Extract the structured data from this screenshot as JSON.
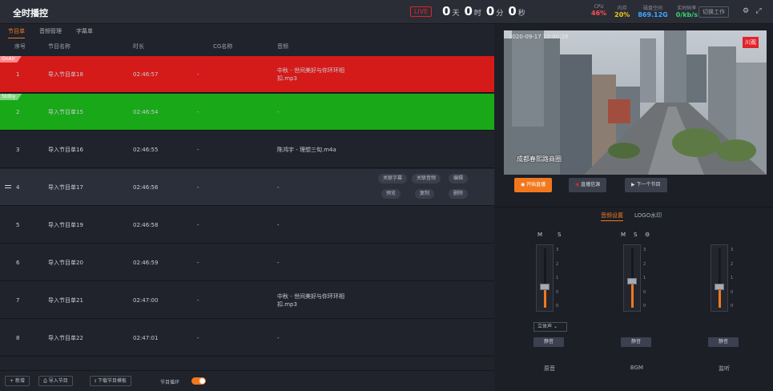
{
  "app": {
    "title": "全时播控"
  },
  "live": {
    "badge": "LIVE"
  },
  "timer": {
    "days": "0",
    "day_unit": "天",
    "hours": "0",
    "hour_unit": "时",
    "minutes": "0",
    "minute_unit": "分",
    "seconds": "0",
    "second_unit": "秒"
  },
  "stats": [
    {
      "label": "CPU",
      "value": "46%",
      "color": "#ff4f4f"
    },
    {
      "label": "内存",
      "value": "20%",
      "color": "#f5c518"
    },
    {
      "label": "磁盘空间",
      "value": "869.12G",
      "color": "#3fa7ff"
    },
    {
      "label": "实时码率",
      "value": "0/kb/s",
      "color": "#36d36e"
    }
  ],
  "top_button": "切换工作",
  "tabs": [
    "节目单",
    "音频管理",
    "字幕单"
  ],
  "columns": {
    "no": "序号",
    "name": "节目名称",
    "duration": "时长",
    "cg": "CG名称",
    "audio": "音频"
  },
  "rows": [
    {
      "no": "1",
      "name": "导入节目单18",
      "duration": "02:46:57",
      "cg": "-",
      "audio": "中秋 - 世间美好与你环环相扣.mp3",
      "tag": "OnAir"
    },
    {
      "no": "2",
      "name": "导入节目单15",
      "duration": "02:46:54",
      "cg": "-",
      "audio": "-",
      "tag": "Stdby"
    },
    {
      "no": "3",
      "name": "导入节目单16",
      "duration": "02:46:55",
      "cg": "-",
      "audio": "陈鸿宇 - 理想三旬.m4a"
    },
    {
      "no": "4",
      "name": "导入节目单17",
      "duration": "02:46:56",
      "cg": "-",
      "audio": "-"
    },
    {
      "no": "5",
      "name": "导入节目单19",
      "duration": "02:46:58",
      "cg": "-",
      "audio": "-"
    },
    {
      "no": "6",
      "name": "导入节目单20",
      "duration": "02:46:59",
      "cg": "-",
      "audio": "-"
    },
    {
      "no": "7",
      "name": "导入节目单21",
      "duration": "02:47:00",
      "cg": "-",
      "audio": "中秋 - 世间美好与你环环相扣.mp3"
    },
    {
      "no": "8",
      "name": "导入节目单22",
      "duration": "02:47:01",
      "cg": "-",
      "audio": "-"
    }
  ],
  "row_actions": {
    "link_subtitle": "关联字幕",
    "link_audio": "关联音频",
    "edit": "编辑",
    "preview": "预览",
    "copy": "复制",
    "delete": "删除"
  },
  "bottom": {
    "add": "新增",
    "import": "导入节目",
    "download_template": "下载节目模板",
    "loop_label": "节目循环",
    "loop_on": true
  },
  "preview": {
    "timestamp": "2020-09-17 12:00:28",
    "logo": "川观",
    "caption": "成都春熙路商圈"
  },
  "controls": {
    "start": "开始直播",
    "switch_source": "直播信源",
    "next_program": "下一个节目"
  },
  "audio_tabs": [
    "音频设置",
    "LOGO水印"
  ],
  "channels": [
    {
      "label": "原音",
      "m": "M",
      "s": "S",
      "select": "立体声",
      "mute": "静音",
      "level": 0.35
    },
    {
      "label": "BGM",
      "m": "M",
      "s": "S",
      "mute": "静音",
      "level": 0.45
    },
    {
      "label": "监听",
      "mute": "静音",
      "level": 0.35
    }
  ],
  "scale_ticks": [
    "3",
    "2",
    "1",
    "0",
    "-1",
    "0"
  ]
}
